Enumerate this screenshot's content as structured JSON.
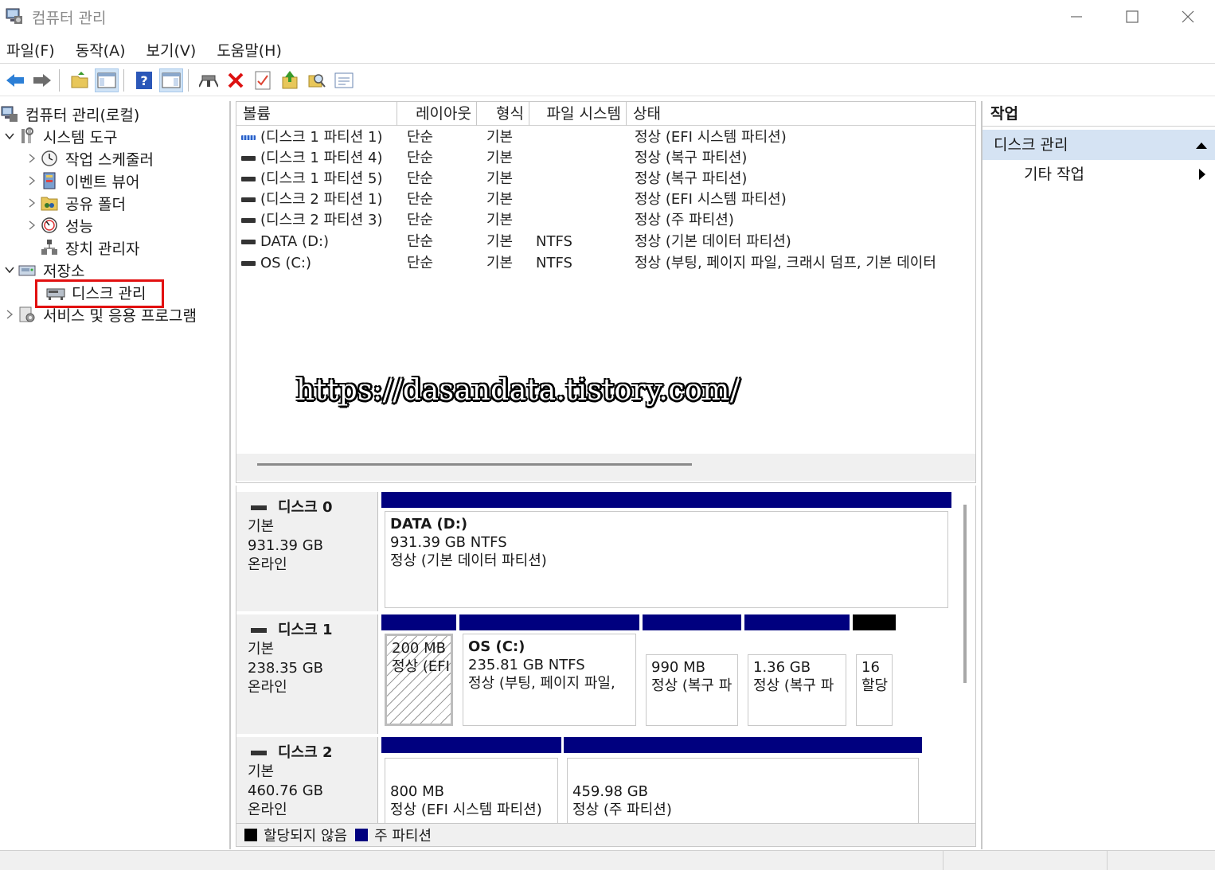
{
  "window": {
    "title": "컴퓨터 관리"
  },
  "menu": [
    "파일(F)",
    "동작(A)",
    "보기(V)",
    "도움말(H)"
  ],
  "toolbar_icons": [
    "back-arrow-icon",
    "forward-arrow-icon",
    "up-folder-icon",
    "show-hide-tree-icon",
    "help-icon",
    "show-hide-action-pane-icon",
    "connect-drive-icon",
    "delete-icon",
    "properties-icon",
    "import-icon",
    "search-icon",
    "settings-list-icon"
  ],
  "tree": {
    "root": "컴퓨터 관리(로컬)",
    "system_tools": "시스템 도구",
    "task_scheduler": "작업 스케줄러",
    "event_viewer": "이벤트 뷰어",
    "shared_folders": "공유 폴더",
    "performance": "성능",
    "device_manager": "장치 관리자",
    "storage": "저장소",
    "disk_management": "디스크 관리",
    "services_apps": "서비스 및 응용 프로그램"
  },
  "volume_table": {
    "headers": [
      "볼륨",
      "레이아웃",
      "형식",
      "파일 시스템",
      "상태"
    ],
    "rows": [
      {
        "volume": "(디스크 1 파티션 1)",
        "layout": "단순",
        "type": "기본",
        "fs": "",
        "status": "정상 (EFI 시스템 파티션)"
      },
      {
        "volume": "(디스크 1 파티션 4)",
        "layout": "단순",
        "type": "기본",
        "fs": "",
        "status": "정상 (복구 파티션)"
      },
      {
        "volume": "(디스크 1 파티션 5)",
        "layout": "단순",
        "type": "기본",
        "fs": "",
        "status": "정상 (복구 파티션)"
      },
      {
        "volume": "(디스크 2 파티션 1)",
        "layout": "단순",
        "type": "기본",
        "fs": "",
        "status": "정상 (EFI 시스템 파티션)"
      },
      {
        "volume": "(디스크 2 파티션 3)",
        "layout": "단순",
        "type": "기본",
        "fs": "",
        "status": "정상 (주 파티션)"
      },
      {
        "volume": "DATA (D:)",
        "layout": "단순",
        "type": "기본",
        "fs": "NTFS",
        "status": "정상 (기본 데이터 파티션)"
      },
      {
        "volume": "OS (C:)",
        "layout": "단순",
        "type": "기본",
        "fs": "NTFS",
        "status": "정상 (부팅, 페이지 파일, 크래시 덤프, 기본 데이터"
      }
    ]
  },
  "watermark": "https://dasandata.tistory.com/",
  "disks": {
    "d0": {
      "name": "디스크 0",
      "type": "기본",
      "size": "931.39 GB",
      "state": "온라인",
      "p1": {
        "l1": "DATA  (D:)",
        "l2": "931.39 GB NTFS",
        "l3": "정상 (기본 데이터 파티션)"
      }
    },
    "d1": {
      "name": "디스크 1",
      "type": "기본",
      "size": "238.35 GB",
      "state": "온라인",
      "p1": {
        "l1": "200 MB",
        "l2": "정상 (EFI"
      },
      "p2": {
        "l1": "OS  (C:)",
        "l2": "235.81 GB NTFS",
        "l3": "정상 (부팅, 페이지 파일,"
      },
      "p3": {
        "l1": "990 MB",
        "l2": "정상 (복구 파"
      },
      "p4": {
        "l1": "1.36 GB",
        "l2": "정상 (복구 파"
      },
      "p5": {
        "l1": "16",
        "l2": "할당"
      }
    },
    "d2": {
      "name": "디스크 2",
      "type": "기본",
      "size": "460.76 GB",
      "state": "온라인",
      "p1": {
        "l1": "800 MB",
        "l2": "정상 (EFI 시스템 파티션)"
      },
      "p2": {
        "l1": "459.98 GB",
        "l2": "정상 (주 파티션)"
      }
    }
  },
  "legend": {
    "unallocated": "할당되지 않음",
    "primary": "주 파티션",
    "unallocated_color": "#000000",
    "primary_color": "#00007f"
  },
  "actions": {
    "header": "작업",
    "section": "디스크 관리",
    "item": "기타 작업"
  }
}
